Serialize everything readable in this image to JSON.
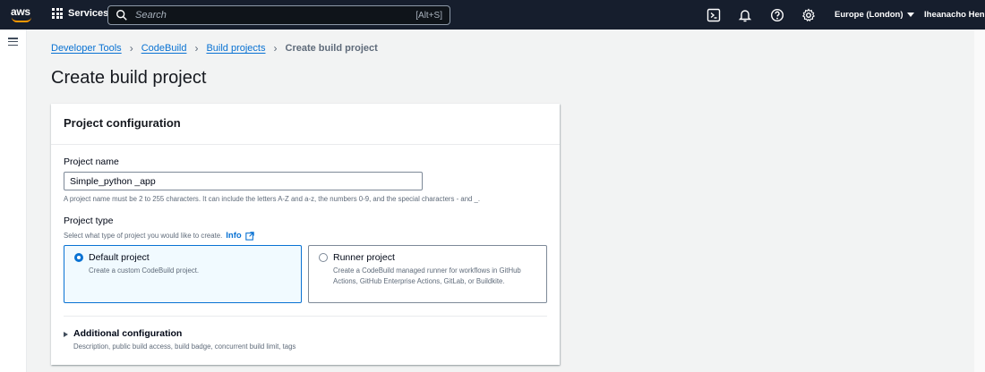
{
  "topnav": {
    "logo_text": "aws",
    "services_label": "Services",
    "search": {
      "placeholder": "Search",
      "shortcut": "[Alt+S]"
    },
    "region": "Europe (London)",
    "user": "Iheanacho Henry"
  },
  "breadcrumb": {
    "items": [
      "Developer Tools",
      "CodeBuild",
      "Build projects"
    ],
    "current": "Create build project"
  },
  "page_title": "Create build project",
  "panel": {
    "title": "Project configuration",
    "project_name": {
      "label": "Project name",
      "value": "Simple_python _app",
      "hint": "A project name must be 2 to 255 characters. It can include the letters A-Z and a-z, the numbers 0-9, and the special characters - and _."
    },
    "project_type": {
      "label": "Project type",
      "description": "Select what type of project you would like to create.",
      "info_link": "Info",
      "options": [
        {
          "label": "Default project",
          "description": "Create a custom CodeBuild project.",
          "selected": true
        },
        {
          "label": "Runner project",
          "description": "Create a CodeBuild managed runner for workflows in GitHub Actions, GitHub Enterprise Actions, GitLab, or Buildkite.",
          "selected": false
        }
      ]
    },
    "additional": {
      "title": "Additional configuration",
      "description": "Description, public build access, build badge, concurrent build limit, tags"
    }
  },
  "colors": {
    "nav_bg": "#161e2d",
    "accent": "#0972d3",
    "aws_orange": "#ff9900"
  }
}
